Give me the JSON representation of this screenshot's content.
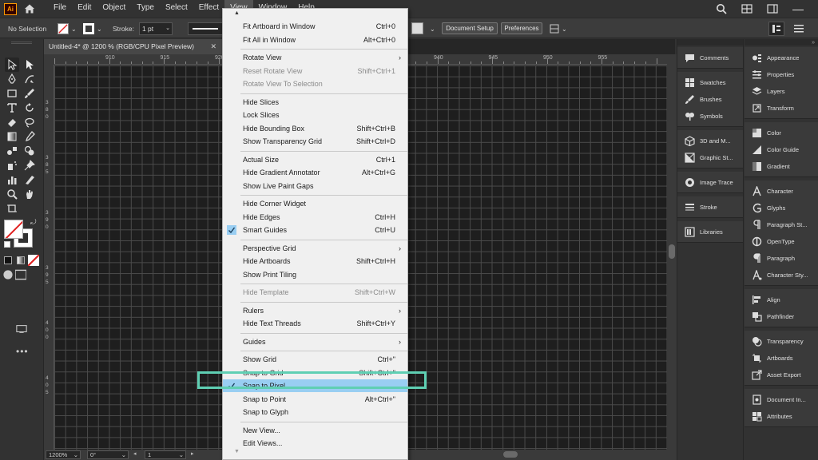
{
  "app": {
    "logo": "Ai"
  },
  "menubar": {
    "items": [
      "File",
      "Edit",
      "Object",
      "Type",
      "Select",
      "Effect",
      "View",
      "Window",
      "Help"
    ]
  },
  "controlbar": {
    "selection_label": "No Selection",
    "stroke_label": "Stroke:",
    "stroke_value": "1 pt",
    "document_setup_label": "Document Setup",
    "preferences_label": "Preferences"
  },
  "document": {
    "tab_title": "Untitled-4* @ 1200 % (RGB/CPU Pixel Preview)",
    "close_glyph": "✕"
  },
  "rulers": {
    "top_ticks": [
      "910",
      "915",
      "920",
      "925",
      "930",
      "935",
      "940",
      "945",
      "950",
      "955"
    ],
    "left_ticks": [
      [
        "3",
        "8",
        "0"
      ],
      [
        "3",
        "8",
        "5"
      ],
      [
        "3",
        "9",
        "0"
      ],
      [
        "3",
        "9",
        "5"
      ],
      [
        "4",
        "0",
        "0"
      ],
      [
        "4",
        "0",
        "5"
      ]
    ]
  },
  "statusbar": {
    "zoom": "1200%",
    "rotation": "0°",
    "artboard": "1"
  },
  "view_menu": {
    "items": [
      {
        "label": "Fit Artboard in Window",
        "shortcut": "Ctrl+0"
      },
      {
        "label": "Fit All in Window",
        "shortcut": "Alt+Ctrl+0"
      },
      {
        "sep": true
      },
      {
        "label": "Rotate View",
        "submenu": true
      },
      {
        "label": "Reset Rotate View",
        "shortcut": "Shift+Ctrl+1",
        "disabled": true
      },
      {
        "label": "Rotate View To Selection",
        "disabled": true
      },
      {
        "sep": true
      },
      {
        "label": "Hide Slices"
      },
      {
        "label": "Lock Slices"
      },
      {
        "label": "Hide Bounding Box",
        "shortcut": "Shift+Ctrl+B"
      },
      {
        "label": "Show Transparency Grid",
        "shortcut": "Shift+Ctrl+D"
      },
      {
        "sep": true
      },
      {
        "label": "Actual Size",
        "shortcut": "Ctrl+1"
      },
      {
        "label": "Hide Gradient Annotator",
        "shortcut": "Alt+Ctrl+G"
      },
      {
        "label": "Show Live Paint Gaps"
      },
      {
        "sep": true
      },
      {
        "label": "Hide Corner Widget"
      },
      {
        "label": "Hide Edges",
        "shortcut": "Ctrl+H"
      },
      {
        "label": "Smart Guides",
        "shortcut": "Ctrl+U",
        "checked": true
      },
      {
        "sep": true
      },
      {
        "label": "Perspective Grid",
        "submenu": true
      },
      {
        "label": "Hide Artboards",
        "shortcut": "Shift+Ctrl+H"
      },
      {
        "label": "Show Print Tiling"
      },
      {
        "sep": true
      },
      {
        "label": "Hide Template",
        "shortcut": "Shift+Ctrl+W",
        "disabled": true
      },
      {
        "sep": true
      },
      {
        "label": "Rulers",
        "submenu": true
      },
      {
        "label": "Hide Text Threads",
        "shortcut": "Shift+Ctrl+Y"
      },
      {
        "sep": true
      },
      {
        "label": "Guides",
        "submenu": true
      },
      {
        "sep": true
      },
      {
        "label": "Show Grid",
        "shortcut": "Ctrl+\""
      },
      {
        "label": "Snap to Grid",
        "shortcut": "Shift+Ctrl+\""
      },
      {
        "label": "Snap to Pixel",
        "checked": true,
        "highlighted": true
      },
      {
        "label": "Snap to Point",
        "shortcut": "Alt+Ctrl+\""
      },
      {
        "label": "Snap to Glyph"
      },
      {
        "sep": true
      },
      {
        "label": "New View..."
      },
      {
        "label": "Edit Views..."
      }
    ]
  },
  "panels_left": {
    "groups": [
      [
        "Comments"
      ],
      [
        "Swatches",
        "Brushes",
        "Symbols"
      ],
      [
        "3D and M...",
        "Graphic St..."
      ],
      [
        "Image Trace"
      ],
      [
        "Stroke"
      ],
      [
        "Libraries"
      ]
    ]
  },
  "panels_right": {
    "groups": [
      [
        "Appearance",
        "Properties",
        "Layers",
        "Transform"
      ],
      [
        "Color",
        "Color Guide",
        "Gradient"
      ],
      [
        "Character",
        "Glyphs",
        "Paragraph St...",
        "OpenType",
        "Paragraph",
        "Character Sty..."
      ],
      [
        "Align",
        "Pathfinder"
      ],
      [
        "Transparency",
        "Artboards",
        "Asset Export"
      ],
      [
        "Document In...",
        "Attributes"
      ]
    ]
  },
  "colors": {
    "menu_highlight": "#99cef2",
    "annotation_box": "#5fcfb3",
    "canvas_bg": "#1e1e1e"
  }
}
